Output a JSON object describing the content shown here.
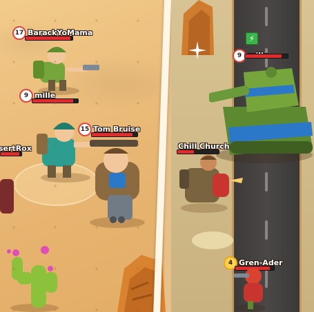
{
  "players": [
    {
      "level": "17",
      "name": "BarackYoMama",
      "hp": 0.95
    },
    {
      "level": "9",
      "name": "mille",
      "hp": 0.9
    },
    {
      "level": "15",
      "name": "Tom Bruise",
      "hp": 0.9
    },
    {
      "level": "",
      "name": "sertRox",
      "hp": 0.9
    },
    {
      "level": "9",
      "name": "mille",
      "hp": 0.85
    },
    {
      "level": "",
      "name": "Chill Church",
      "hp": 0.4
    },
    {
      "level": "4",
      "name": "Gren-Ader",
      "hp": 0.9
    }
  ],
  "colors": {
    "sand": "#e8b673",
    "road": "#444140",
    "tank": "#6b9a3b",
    "tank_stripe": "#2a78c7",
    "hp": "#e02c2c",
    "badge_gold": "#ffd34d"
  },
  "icons": {
    "tank_driver": "lightning-bolt-icon"
  }
}
